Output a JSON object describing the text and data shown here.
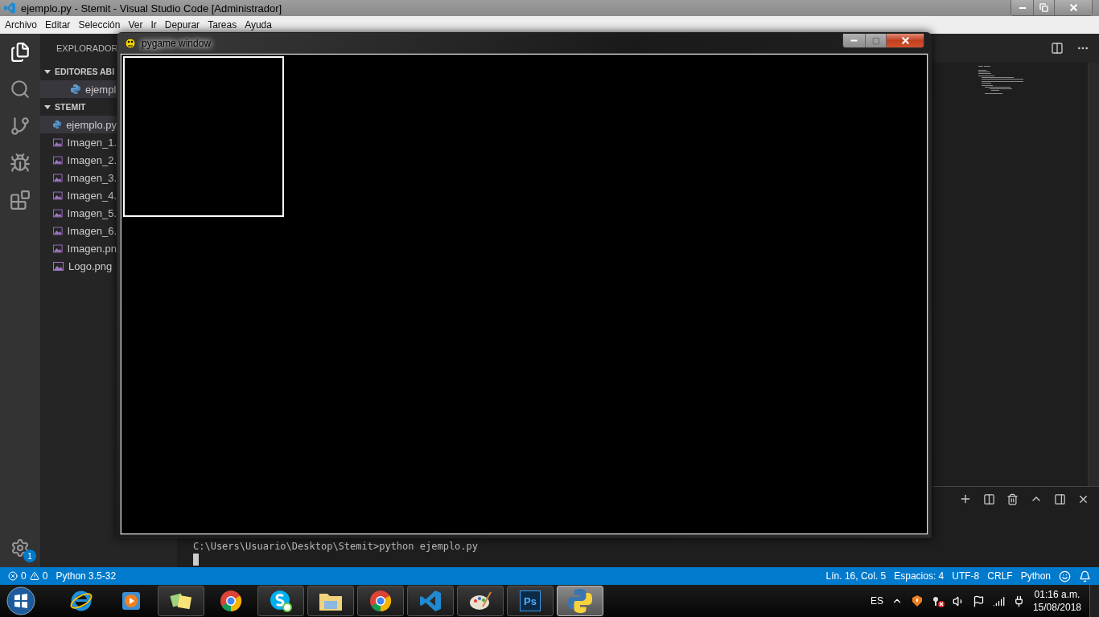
{
  "window": {
    "title": "ejemplo.py - Stemit - Visual Studio Code [Administrador]"
  },
  "menu": [
    "Archivo",
    "Editar",
    "Selección",
    "Ver",
    "Ir",
    "Depurar",
    "Tareas",
    "Ayuda"
  ],
  "activity_bar": [
    {
      "kind": "files",
      "selected": true
    },
    {
      "kind": "search",
      "selected": false
    },
    {
      "kind": "git",
      "selected": false
    },
    {
      "kind": "debug",
      "selected": false
    },
    {
      "kind": "extensions",
      "selected": false
    }
  ],
  "settings_badge": "1",
  "sidebar": {
    "title": "EXPLORADOR",
    "open_editors": {
      "title": "EDITORES ABI",
      "expanded": true,
      "items": [
        {
          "label": "ejempl",
          "kind": "python",
          "selected": true
        }
      ]
    },
    "folder": {
      "title": "STEMIT",
      "expanded": true,
      "items": [
        {
          "label": "ejemplo.py",
          "kind": "python",
          "selected": true
        },
        {
          "label": "Imagen_1.",
          "kind": "image",
          "selected": false
        },
        {
          "label": "Imagen_2.",
          "kind": "image",
          "selected": false
        },
        {
          "label": "Imagen_3.",
          "kind": "image",
          "selected": false
        },
        {
          "label": "Imagen_4.",
          "kind": "image",
          "selected": false
        },
        {
          "label": "Imagen_5.",
          "kind": "image",
          "selected": false
        },
        {
          "label": "Imagen_6.",
          "kind": "image",
          "selected": false
        },
        {
          "label": "Imagen.pn",
          "kind": "image",
          "selected": false
        },
        {
          "label": "Logo.png",
          "kind": "image",
          "selected": false
        }
      ]
    }
  },
  "terminal": {
    "lines": [
      "C:\\Users\\Usuario\\Desktop\\Stemit>python ejemplo.py"
    ]
  },
  "status_bar": {
    "errors": "0",
    "warnings": "0",
    "interpreter": "Python 3.5-32",
    "right": [
      "Lín. 16, Col. 5",
      "Espacios: 4",
      "UTF-8",
      "CRLF",
      "Python"
    ]
  },
  "pygame_window": {
    "title": "pygame window"
  },
  "taskbar": {
    "items": [
      {
        "kind": "ie",
        "running": false
      },
      {
        "kind": "media",
        "running": false
      },
      {
        "kind": "notes",
        "running": true
      },
      {
        "kind": "chrome",
        "running": false
      },
      {
        "kind": "skype",
        "running": true
      },
      {
        "kind": "explorer",
        "running": true
      },
      {
        "kind": "chrome",
        "running": true
      },
      {
        "kind": "vscode",
        "running": true
      },
      {
        "kind": "paint",
        "running": true
      },
      {
        "kind": "photoshop",
        "running": true,
        "label": "Ps"
      },
      {
        "kind": "python",
        "running": true,
        "selected": true
      }
    ],
    "language": "ES",
    "time": "01:16 a.m.",
    "date": "15/08/2018"
  }
}
